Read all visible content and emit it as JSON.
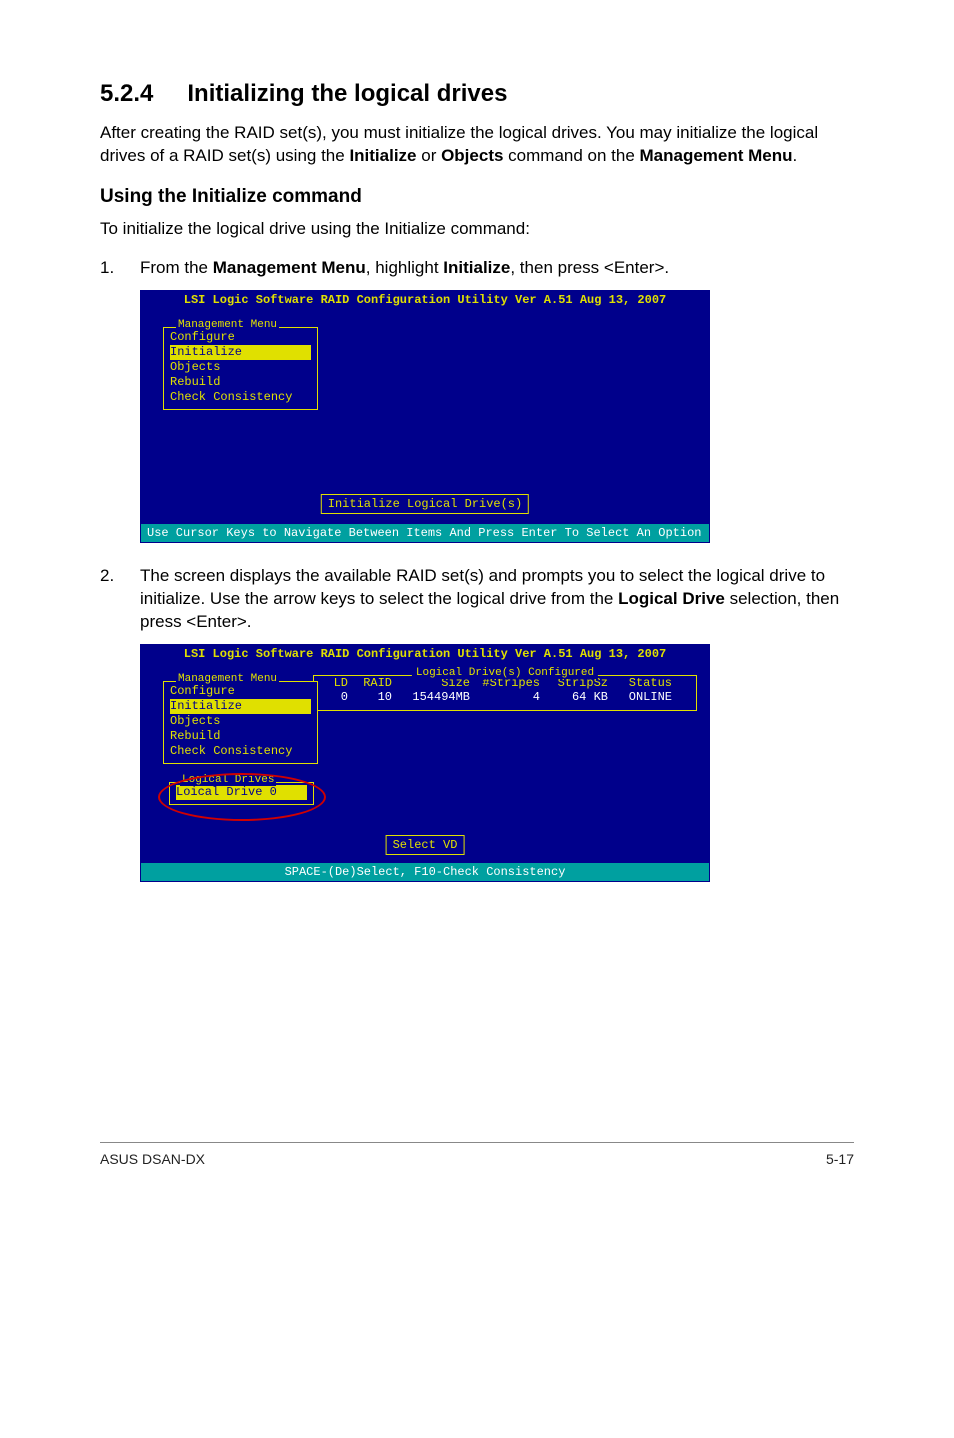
{
  "section": {
    "number": "5.2.4",
    "title": "Initializing the logical drives"
  },
  "intro": {
    "p1_prefix": "After creating the RAID set(s), you must initialize the logical drives. You may initialize the logical drives of a RAID set(s) using the ",
    "initialize_word": "Initialize",
    "or_word": " or ",
    "objects_word": "Objects",
    "p1_suffix": " command on the ",
    "mgmt_menu_word": "Management Menu",
    "period": "."
  },
  "sub_heading": "Using the Initialize command",
  "sub_body": "To initialize the logical drive using the Initialize command:",
  "step1": {
    "num": "1.",
    "prefix": "From the ",
    "mgmt_menu": "Management Menu",
    "mid": ", highlight ",
    "init": "Initialize",
    "suffix": ", then press <Enter>."
  },
  "bios1": {
    "title": "LSI Logic Software RAID Configuration Utility Ver A.51 Aug 13, 2007",
    "menu_label": "Management Menu",
    "items": [
      "Configure",
      "Initialize",
      "Objects",
      "Rebuild",
      "Check Consistency"
    ],
    "selected_index": 1,
    "hint": "Initialize Logical Drive(s)",
    "footer": "Use Cursor Keys to Navigate Between Items And Press Enter To Select An Option"
  },
  "step2": {
    "num": "2.",
    "prefix": "The screen displays the available RAID set(s) and prompts you to select the logical drive to initialize. Use the arrow keys to select the logical drive from the ",
    "logical_drive": "Logical Drive",
    "suffix": " selection, then press <Enter>."
  },
  "bios2": {
    "title": "LSI Logic Software RAID Configuration Utility Ver A.51 Aug 13, 2007",
    "menu_label": "Management Menu",
    "items": [
      "Configure",
      "Initialize",
      "Objects",
      "Rebuild",
      "Check Consistency"
    ],
    "selected_index": 1,
    "ld_panel_label": "Logical Drive(s) Configured",
    "ld_headers": {
      "ld": "LD",
      "raid": "RAID",
      "size": "Size",
      "stripes": "#Stripes",
      "stripsz": "StripSz",
      "status": "Status"
    },
    "ld_row": {
      "ld": "0",
      "raid": "10",
      "size": "154494MB",
      "stripes": "4",
      "stripsz": "64 KB",
      "status": "ONLINE"
    },
    "logical_drives_label": "Logical Drives",
    "logical_drives_item": "Loical Drive 0",
    "hint": "Select VD",
    "footer": "SPACE-(De)Select, F10-Check Consistency"
  },
  "footer": {
    "left": "ASUS DSAN-DX",
    "right": "5-17"
  }
}
